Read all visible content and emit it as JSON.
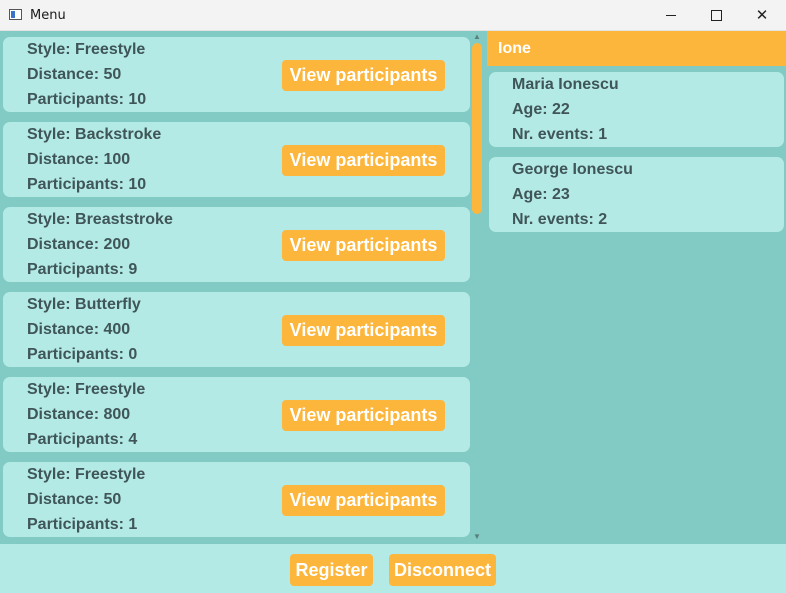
{
  "window": {
    "title": "Menu",
    "minimize_glyph": "",
    "maximize_glyph": "",
    "close_glyph": "✕"
  },
  "races": [
    {
      "style": "Style: Freestyle",
      "distance": "Distance: 50",
      "participants": "Participants: 10",
      "button": "View participants"
    },
    {
      "style": "Style: Backstroke",
      "distance": "Distance: 100",
      "participants": "Participants: 10",
      "button": "View participants"
    },
    {
      "style": "Style: Breaststroke",
      "distance": "Distance: 200",
      "participants": "Participants: 9",
      "button": "View participants"
    },
    {
      "style": "Style: Butterfly",
      "distance": "Distance: 400",
      "participants": "Participants: 0",
      "button": "View participants"
    },
    {
      "style": "Style: Freestyle",
      "distance": "Distance: 800",
      "participants": "Participants: 4",
      "button": "View participants"
    },
    {
      "style": "Style: Freestyle",
      "distance": "Distance: 50",
      "participants": "Participants: 1",
      "button": "View participants"
    }
  ],
  "search": {
    "value": "Ione"
  },
  "people": [
    {
      "name": "Maria Ionescu",
      "age": "Age: 22",
      "events": "Nr. events: 1"
    },
    {
      "name": "George Ionescu",
      "age": "Age: 23",
      "events": "Nr. events: 2"
    }
  ],
  "footer": {
    "register_label": "Register",
    "disconnect_label": "Disconnect"
  },
  "colors": {
    "background": "#82cbc4",
    "card": "#b4eae6",
    "accent": "#fdb63c",
    "text": "#3f5557"
  },
  "icons": {
    "app": "window-app-icon",
    "scroll_up": "chevron-up-icon",
    "scroll_down": "chevron-down-icon"
  }
}
